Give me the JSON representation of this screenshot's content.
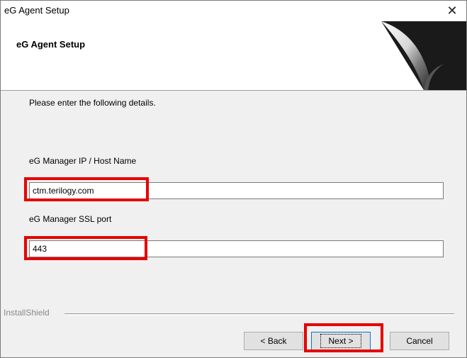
{
  "window": {
    "title": "eG Agent Setup",
    "close_glyph": "✕"
  },
  "header": {
    "heading": "eG Agent Setup"
  },
  "content": {
    "instruction": "Please enter the following details.",
    "ip_label": "eG Manager IP / Host Name",
    "ip_value": "ctm.terilogy.com",
    "port_label": "eG Manager SSL port",
    "port_value": "443"
  },
  "footer": {
    "brand": "InstallShield",
    "back_label": "< Back",
    "next_label": "Next >",
    "cancel_label": "Cancel"
  },
  "colors": {
    "highlight": "#e60000",
    "dialog_bg": "#f0f0f0",
    "focus_border": "#0078d7"
  }
}
